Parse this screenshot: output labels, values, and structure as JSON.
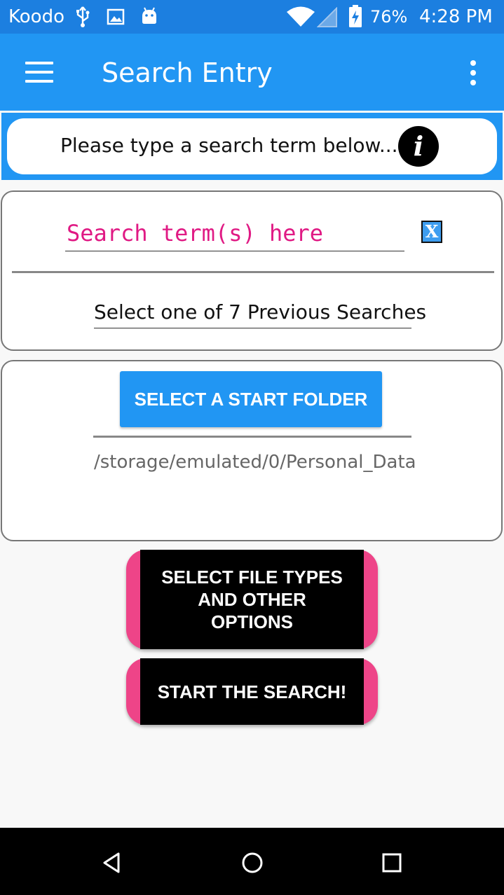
{
  "status_bar": {
    "carrier": "Koodo",
    "battery_percent": "76%",
    "time": "4:28 PM",
    "icons": [
      "usb-icon",
      "image-icon",
      "android-icon",
      "wifi-icon",
      "signal-icon",
      "battery-charging-icon"
    ]
  },
  "app_bar": {
    "title": "Search Entry",
    "color": "#2196f3"
  },
  "hint": {
    "text": "Please type a search term below...",
    "info_icon_glyph": "i"
  },
  "search": {
    "placeholder": "Search term(s) here",
    "value": "",
    "clear_label": "X",
    "previous_searches_label": "Select one of 7 Previous Searches"
  },
  "folder": {
    "button_label": "SELECT A START FOLDER",
    "path": "/storage/emulated/0/Personal_Data"
  },
  "actions": {
    "options_label": "SELECT FILE TYPES AND OTHER OPTIONS",
    "search_label": "START THE SEARCH!",
    "accent_color": "#ee4488"
  },
  "nav_bar": {
    "icons": [
      "back-icon",
      "home-icon",
      "recents-icon"
    ]
  }
}
